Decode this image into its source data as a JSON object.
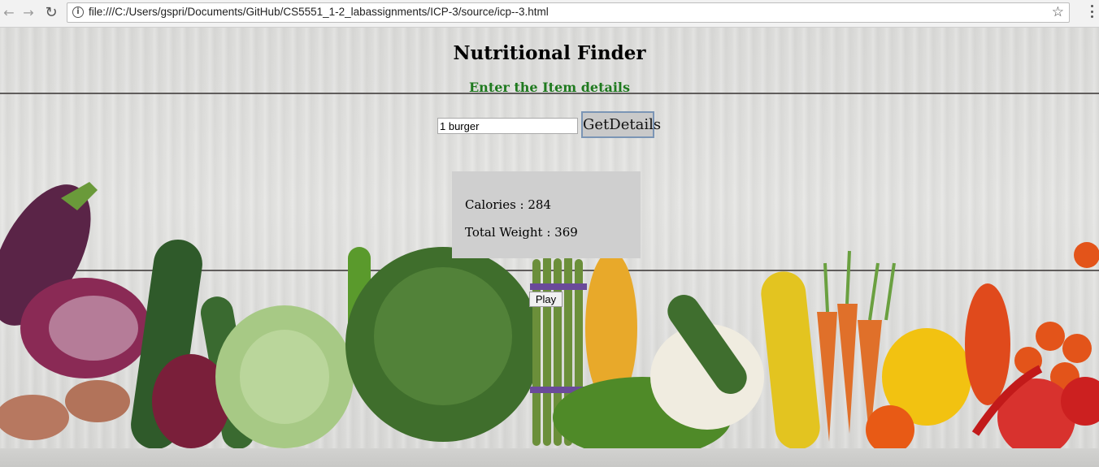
{
  "browser": {
    "url": "file:///C:/Users/gspri/Documents/GitHub/CS5551_1-2_labassignments/ICP-3/source/icp--3.html",
    "back_icon": "arrow-left-icon",
    "forward_icon": "arrow-right-icon",
    "reload_icon": "reload-icon",
    "info_icon": "info-icon",
    "bookmark_icon": "star-icon",
    "menu_icon": "kebab-menu-icon"
  },
  "page": {
    "title": "Nutritional Finder",
    "subtitle": "Enter the Item details",
    "title_color": "#000000",
    "subtitle_color": "#1f7a1f",
    "item_input_value": "1 burger",
    "get_details_label": "GetDetails",
    "results": {
      "calories_label": "Calories : 284",
      "weight_label": "Total Weight : 369"
    },
    "play_label": "Play"
  }
}
